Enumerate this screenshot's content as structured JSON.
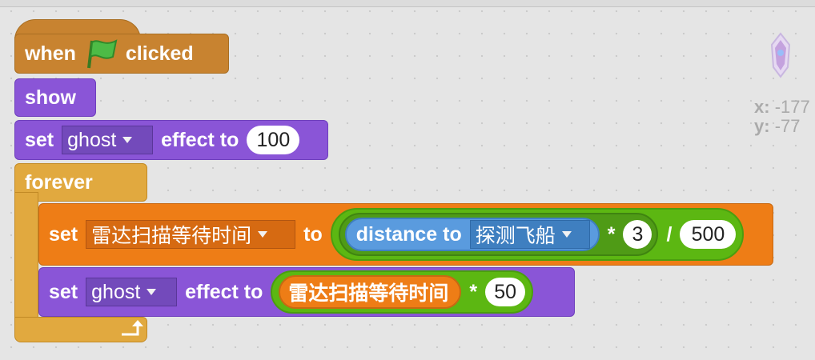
{
  "script": {
    "hat": {
      "when": "when",
      "clicked": "clicked"
    },
    "show": {
      "label": "show"
    },
    "set_ghost_1": {
      "set": "set",
      "effect": "ghost",
      "effect_to": "effect to",
      "value": "100"
    },
    "forever": {
      "label": "forever"
    },
    "set_var": {
      "set": "set",
      "variable": "雷达扫描等待时间",
      "to": "to",
      "distance_to": "distance to",
      "target": "探测飞船",
      "times": "*",
      "times_value": "3",
      "divide": "/",
      "divide_value": "500"
    },
    "set_ghost_2": {
      "set": "set",
      "effect": "ghost",
      "effect_to": "effect to",
      "variable": "雷达扫描等待时间",
      "times": "*",
      "times_value": "50"
    }
  },
  "sprite_info": {
    "x_label": "x:",
    "x_value": "-177",
    "y_label": "y:",
    "y_value": "-77"
  },
  "icons": {
    "green_flag": "green-flag-icon",
    "loop_arrow": "loop-arrow-icon",
    "dropdown": "caret-down-icon"
  },
  "colors": {
    "looks": "#8a55d7",
    "control": "#e1a93f",
    "events": "#c88330",
    "data": "#ee7d16",
    "sensing": "#5a9bde",
    "operators": "#5cb712",
    "background": "#e5e5e5"
  }
}
